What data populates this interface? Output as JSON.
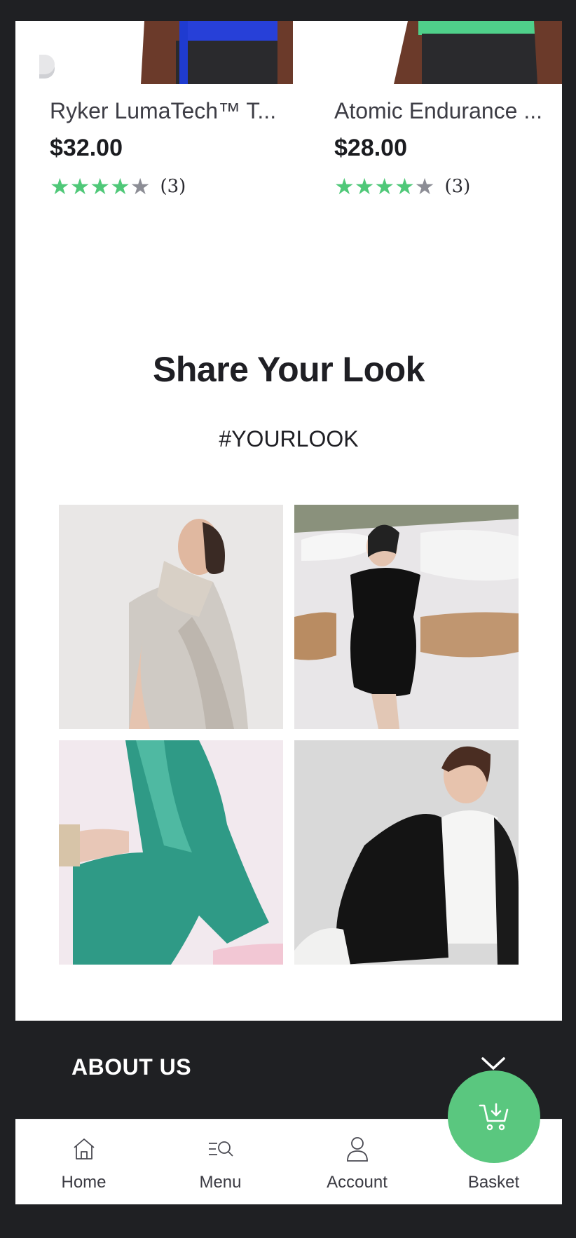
{
  "products": [
    {
      "name": "Ryker LumaTech™ T...",
      "price": "$32.00",
      "rating": 4,
      "max_rating": 5,
      "review_count": "(3)",
      "shirt_color": "#2740d8"
    },
    {
      "name": "Atomic Endurance ...",
      "price": "$28.00",
      "rating": 4,
      "max_rating": 5,
      "review_count": "(3)",
      "shirt_color": "#4fd08a"
    }
  ],
  "share": {
    "title": "Share Your Look",
    "hashtag": "#YOURLOOK"
  },
  "about": {
    "title": "ABOUT US"
  },
  "nav": {
    "items": [
      {
        "label": "Home",
        "icon": "home-icon"
      },
      {
        "label": "Menu",
        "icon": "menu-search-icon"
      },
      {
        "label": "Account",
        "icon": "account-icon"
      },
      {
        "label": "Basket",
        "icon": "basket-icon"
      }
    ]
  },
  "colors": {
    "accent": "#5ac77f",
    "star_on": "#4fc878",
    "star_off": "#8c8d95",
    "dark_bg": "#1f2023"
  }
}
